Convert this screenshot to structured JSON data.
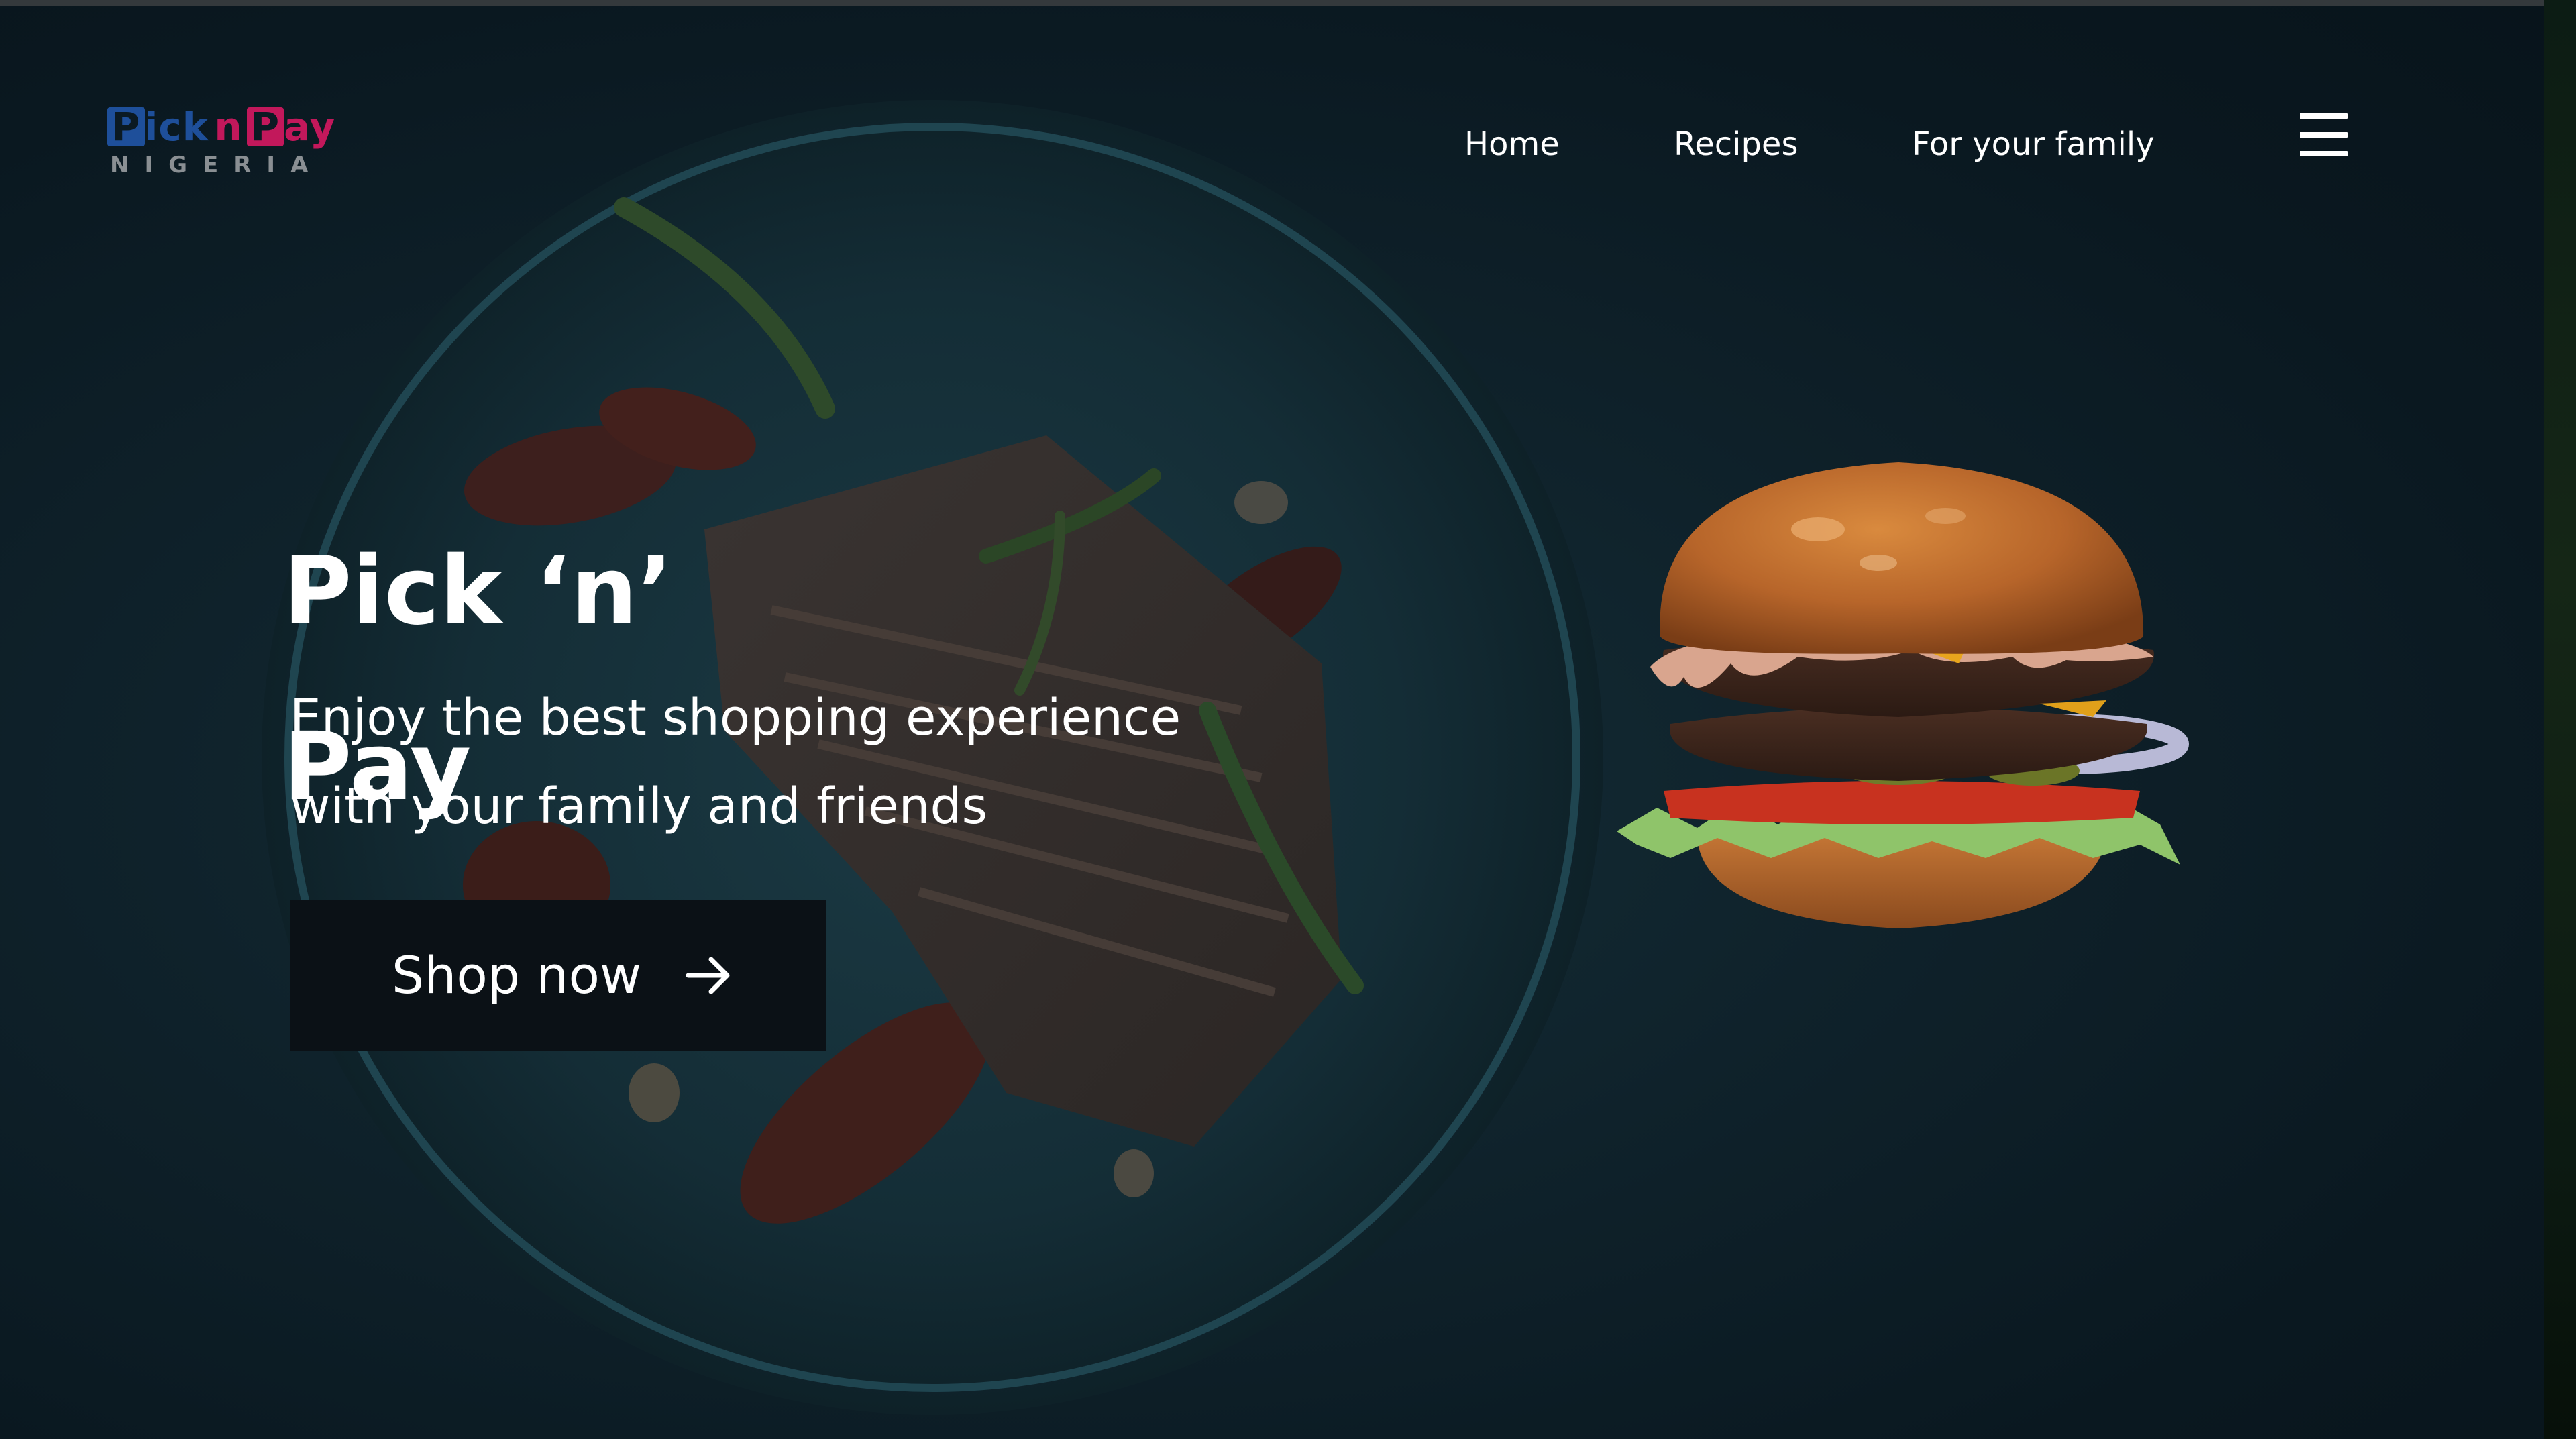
{
  "logo": {
    "brand_part1_initial": "P",
    "brand_part1_rest": "ick",
    "brand_part2_n": "n",
    "brand_part3_initial": "P",
    "brand_part3_rest": "ay",
    "country": "NIGERIA",
    "colors": {
      "blue": "#1e4f9a",
      "magenta": "#c2185b"
    }
  },
  "nav": {
    "items": [
      {
        "label": "Home"
      },
      {
        "label": "Recipes"
      },
      {
        "label": "For your family"
      }
    ],
    "menu_icon": "hamburger-icon"
  },
  "hero": {
    "title": "Pick ‘n’ Pay",
    "tagline": "Enjoy the best shopping experience with your family and friends",
    "cta_label": "Shop now",
    "cta_icon": "arrow-right-icon"
  },
  "colors": {
    "background": "#0b1a23",
    "text": "#ffffff",
    "button_bg": "#0b1116"
  }
}
